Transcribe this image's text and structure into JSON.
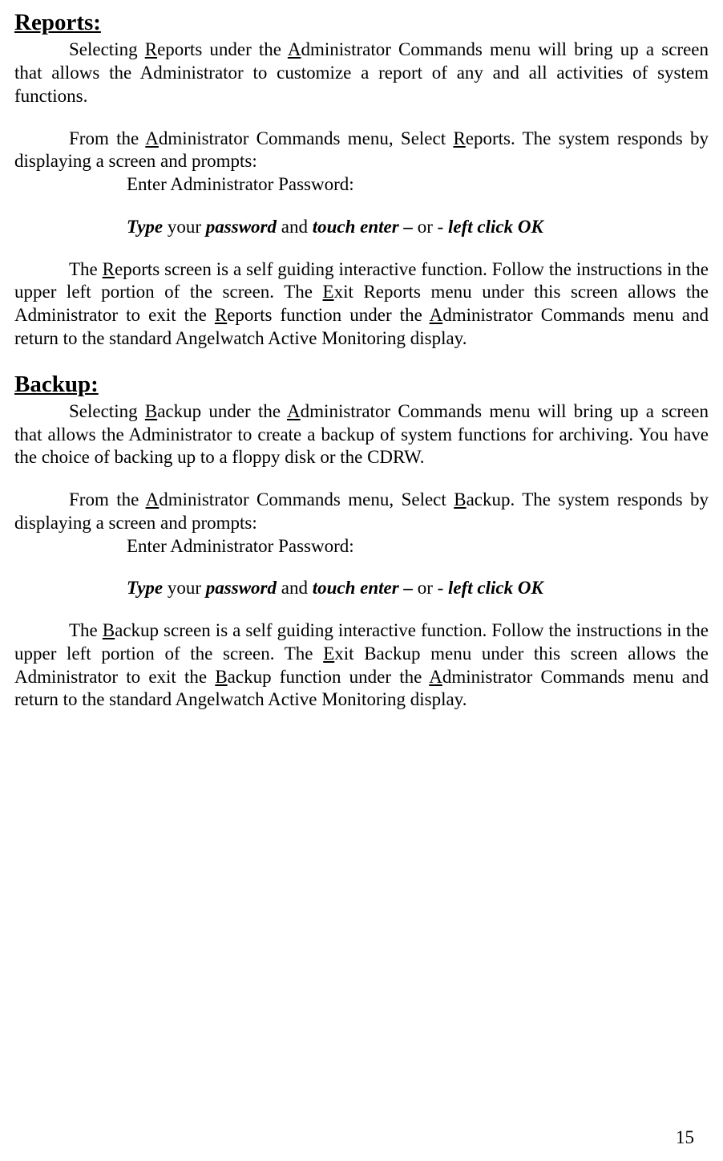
{
  "headings": {
    "reports": "Reports:",
    "backup": "Backup:"
  },
  "reports": {
    "p1a": "Selecting ",
    "p1b": "eports under the ",
    "p1c": "dministrator Commands menu will bring up a screen that allows the Administrator to customize a report of any and all activities of system functions.",
    "p2a": "From the ",
    "p2b": "dministrator Commands menu, Select ",
    "p2c": "eports. The system responds by displaying a screen and prompts:",
    "prompt": "Enter Administrator Password:",
    "action_type": "Type",
    "action_mid1": " your ",
    "action_pw": "password",
    "action_mid2": " and ",
    "action_touch": "touch enter –",
    "action_or": " or -  ",
    "action_click": "left click OK",
    "p3a": "The ",
    "p3b": "eports screen is a self guiding interactive function. Follow the instructions in the upper left portion of the screen. The ",
    "p3c": "xit Reports menu under this screen allows the Administrator to exit the ",
    "p3d": "eports function under the ",
    "p3e": "dministrator Commands menu and return to the standard Angelwatch Active Monitoring display."
  },
  "backup": {
    "p1a": "Selecting ",
    "p1b": "ackup under the ",
    "p1c": "dministrator Commands menu will bring up a screen that allows the Administrator to create a backup of system functions for archiving. You have the choice of backing up to a floppy disk or the CDRW.",
    "p2a": "From the ",
    "p2b": "dministrator Commands menu, Select ",
    "p2c": "ackup. The system responds by displaying a screen and prompts:",
    "prompt": "Enter Administrator Password:",
    "action_type": "Type",
    "action_mid1": " your ",
    "action_pw": "password",
    "action_mid2": " and ",
    "action_touch": "touch enter –",
    "action_or": " or -  ",
    "action_click": "left click OK",
    "p3a": "The ",
    "p3b": "ackup screen is a self guiding interactive function. Follow the instructions in the upper left portion of the screen. The ",
    "p3c": "xit Backup menu under this screen allows the Administrator to exit the ",
    "p3d": "ackup function under the ",
    "p3e": "dministrator Commands menu and return to the standard Angelwatch Active Monitoring display."
  },
  "letters": {
    "R": "R",
    "A": "A",
    "E": "E",
    "B": "B"
  },
  "page_number": "15"
}
